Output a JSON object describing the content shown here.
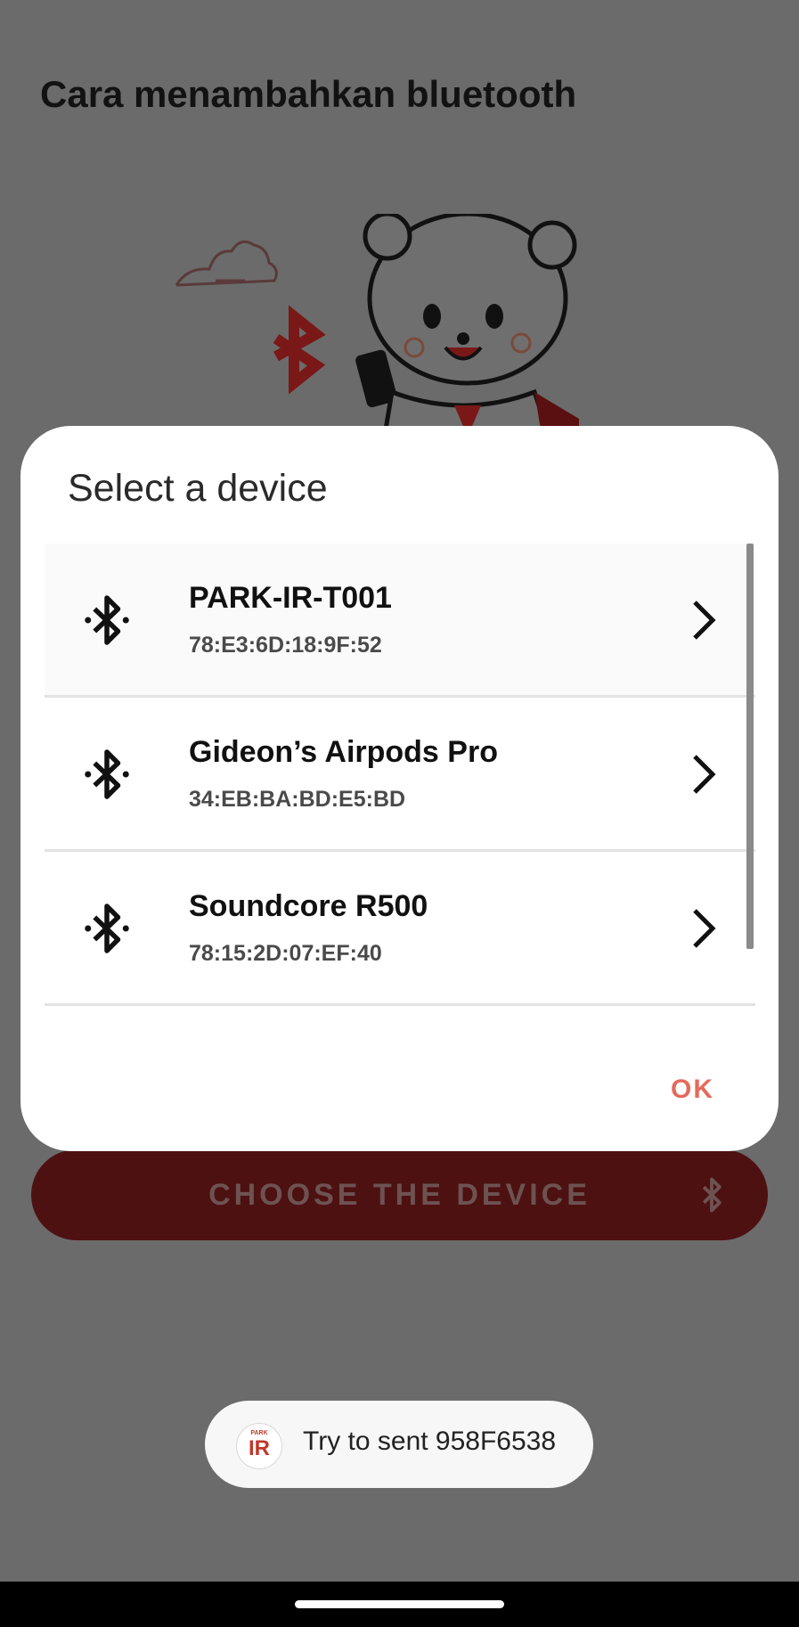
{
  "page": {
    "title": "Cara menambahkan bluetooth"
  },
  "choose_button": {
    "label": "CHOOSE THE DEVICE",
    "icon": "bluetooth-icon"
  },
  "dialog": {
    "title": "Select a device",
    "devices": [
      {
        "name": "PARK-IR-T001",
        "mac": "78:E3:6D:18:9F:52",
        "icon": "bluetooth-icon"
      },
      {
        "name": "Gideon’s Airpods Pro",
        "mac": "34:EB:BA:BD:E5:BD",
        "icon": "bluetooth-icon"
      },
      {
        "name": "Soundcore R500",
        "mac": "78:15:2D:07:EF:40",
        "icon": "bluetooth-icon"
      }
    ],
    "ok_label": "OK"
  },
  "toast": {
    "logo_small": "PARK",
    "logo_big": "IR",
    "message": "Try to sent 958F6538"
  },
  "colors": {
    "scrim": "#6b6b6b",
    "dialog_bg": "#ffffff",
    "accent": "#e56a5c",
    "choose_button_bg": "#4d1111"
  }
}
